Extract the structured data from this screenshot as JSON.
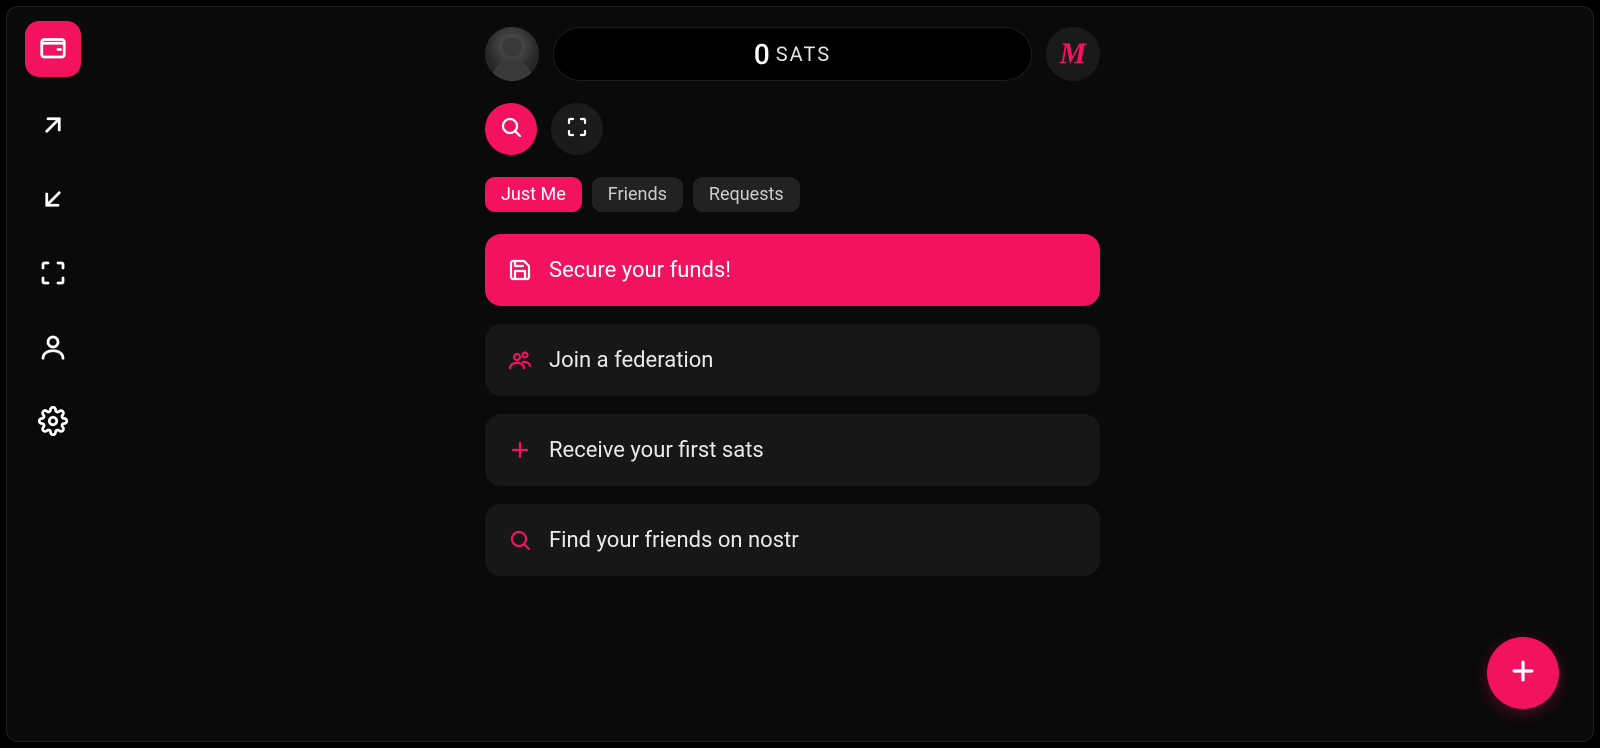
{
  "colors": {
    "accent": "#f31260",
    "panel": "#171717",
    "bg": "#0a0a0a"
  },
  "sidebar": {
    "items": [
      {
        "name": "wallet",
        "active": true
      },
      {
        "name": "send",
        "active": false
      },
      {
        "name": "receive",
        "active": false
      },
      {
        "name": "scan",
        "active": false
      },
      {
        "name": "profile",
        "active": false
      },
      {
        "name": "settings",
        "active": false
      }
    ]
  },
  "header": {
    "balance_amount": "0",
    "balance_unit": "SATS",
    "mint_initial": "M"
  },
  "action_buttons": {
    "search": "search",
    "scan": "scan"
  },
  "tabs": [
    {
      "label": "Just Me",
      "active": true
    },
    {
      "label": "Friends",
      "active": false
    },
    {
      "label": "Requests",
      "active": false
    }
  ],
  "cards": [
    {
      "icon": "save",
      "label": "Secure your funds!",
      "primary": true
    },
    {
      "icon": "people",
      "label": "Join a federation",
      "primary": false
    },
    {
      "icon": "plus",
      "label": "Receive your first sats",
      "primary": false
    },
    {
      "icon": "search",
      "label": "Find your friends on nostr",
      "primary": false
    }
  ],
  "fab": {
    "icon": "plus"
  }
}
